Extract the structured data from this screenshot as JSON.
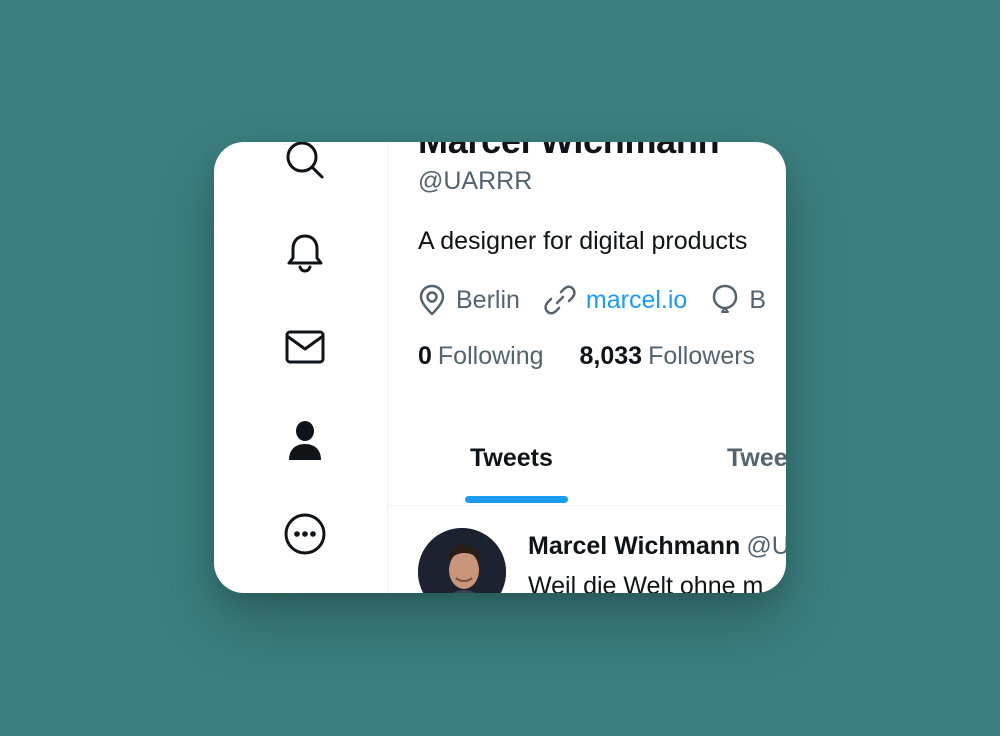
{
  "profile": {
    "display_name": "Marcel Wichmann",
    "handle": "@UARRR",
    "bio": "A designer for digital products",
    "location": "Berlin",
    "website": "marcel.io",
    "birthday_partial": "B"
  },
  "stats": {
    "following_count": "0",
    "following_label": "Following",
    "followers_count": "8,033",
    "followers_label": "Followers"
  },
  "tabs": [
    {
      "label": "Tweets",
      "active": true
    },
    {
      "label": "Tweets & replies",
      "active": false
    }
  ],
  "tweet": {
    "author": "Marcel Wichmann",
    "author_handle": "@UARRR",
    "text": "Weil die Welt ohne m"
  },
  "sidebar": {
    "items": [
      {
        "icon": "search-icon"
      },
      {
        "icon": "bell-icon"
      },
      {
        "icon": "mail-icon"
      },
      {
        "icon": "profile-icon"
      },
      {
        "icon": "more-icon"
      }
    ]
  },
  "colors": {
    "background": "#3b7f7e",
    "card": "#ffffff",
    "accent": "#1d9bf0",
    "text_primary": "#0f1419",
    "text_secondary": "#536471"
  }
}
